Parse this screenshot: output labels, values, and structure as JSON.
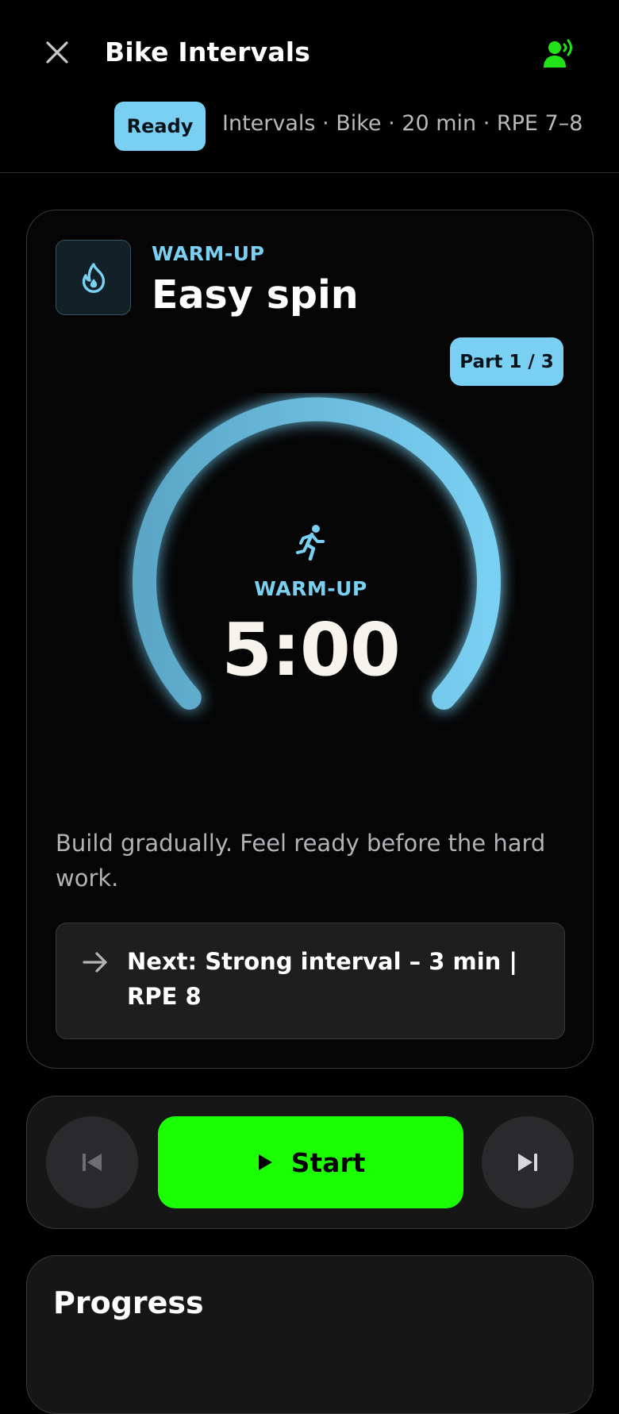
{
  "header": {
    "title": "Bike Intervals",
    "status_badge": "Ready",
    "meta": "Intervals · Bike · 20 min · RPE 7–8"
  },
  "icons": {
    "close": "close-icon",
    "voice": "voice-coach-icon",
    "phase": "flame-icon",
    "runner": "runner-icon",
    "arrow": "arrow-right-icon",
    "prev": "skip-previous-icon",
    "play": "play-icon",
    "next": "skip-next-icon"
  },
  "colors": {
    "accent": "#7ad0f2",
    "start": "#1bff00",
    "voice": "#22e31a"
  },
  "current": {
    "phase_label": "WARM-UP",
    "name": "Easy spin",
    "part": "Part 1 / 3",
    "gauge_label": "WARM-UP",
    "time": "5:00",
    "description": "Build gradually. Feel ready before the hard work.",
    "next": "Next: Strong interval – 3 min | RPE 8"
  },
  "controls": {
    "start_label": "Start"
  },
  "progress": {
    "title": "Progress"
  }
}
